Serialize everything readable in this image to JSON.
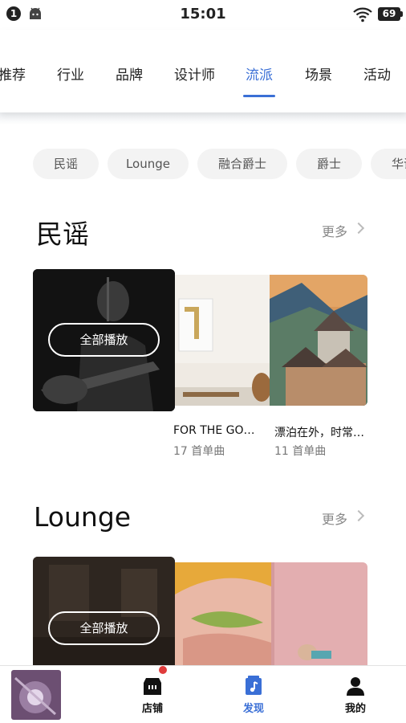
{
  "status_bar": {
    "notification_count": "1",
    "time": "15:01",
    "battery": "69"
  },
  "tabs": [
    {
      "label": "推荐"
    },
    {
      "label": "行业"
    },
    {
      "label": "品牌"
    },
    {
      "label": "设计师"
    },
    {
      "label": "流派",
      "active": true
    },
    {
      "label": "场景"
    },
    {
      "label": "活动"
    }
  ],
  "chips": [
    "民谣",
    "Lounge",
    "融合爵士",
    "爵士",
    "华语"
  ],
  "sections": [
    {
      "title": "民谣",
      "more_label": "更多",
      "play_all_label": "全部播放",
      "cards": [
        {
          "title": "FOR THE GO…",
          "subtitle": "17 首单曲"
        },
        {
          "title": "漂泊在外，时常…",
          "subtitle": "11 首单曲"
        }
      ]
    },
    {
      "title": "Lounge",
      "more_label": "更多",
      "play_all_label": "全部播放"
    }
  ],
  "bottom_nav": [
    {
      "label": "店铺",
      "icon": "store-icon",
      "has_badge": true
    },
    {
      "label": "发现",
      "icon": "discover-music-icon",
      "active": true
    },
    {
      "label": "我的",
      "icon": "person-icon"
    }
  ],
  "colors": {
    "accent": "#3a6fd6",
    "badge": "#e03c3c",
    "chip_bg": "#f3f3f3"
  }
}
